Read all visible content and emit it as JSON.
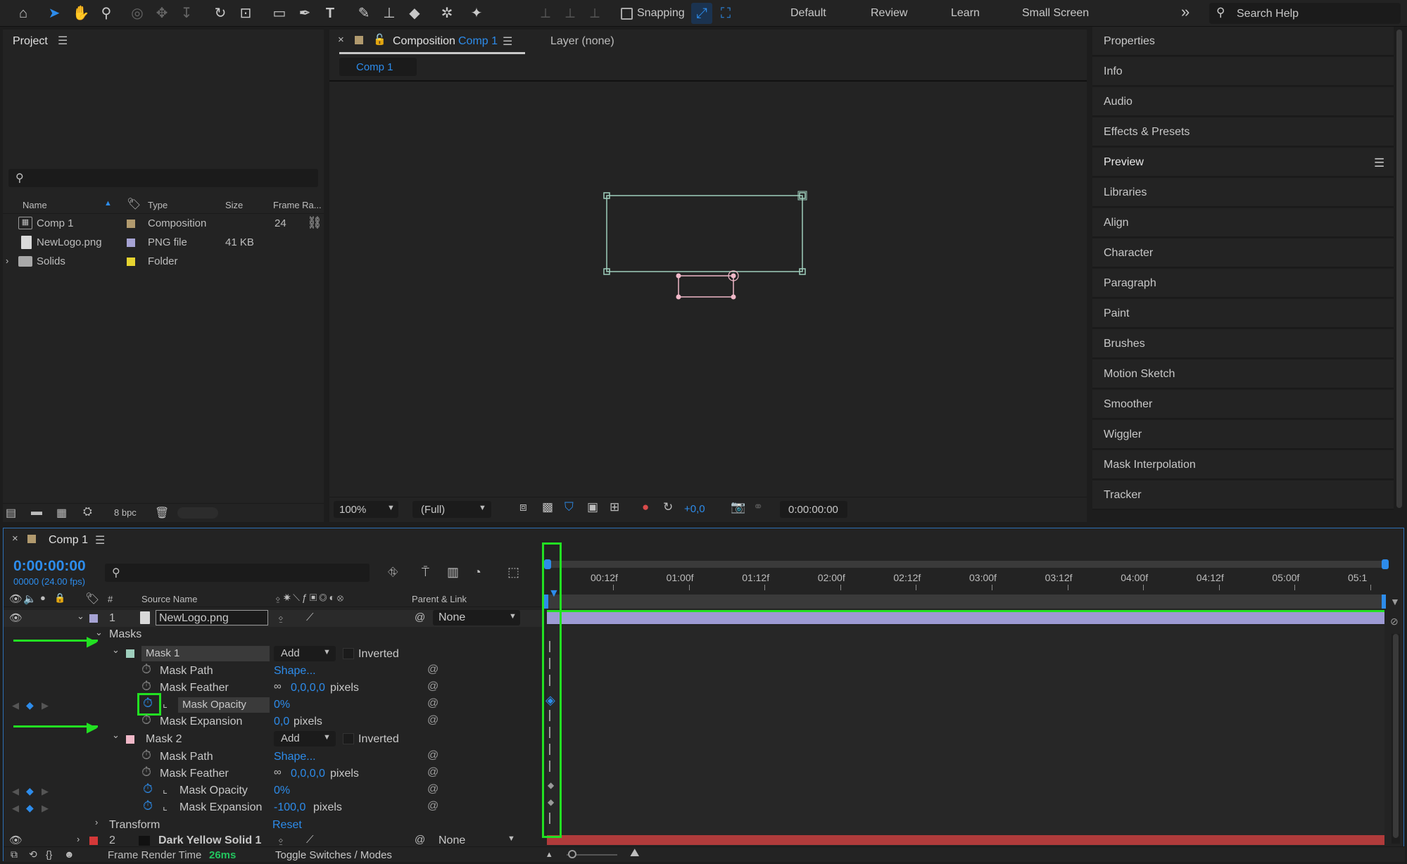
{
  "toolbar": {
    "snapping_label": "Snapping",
    "workspaces": [
      "Default",
      "Review",
      "Learn",
      "Small Screen"
    ],
    "search_placeholder": "Search Help",
    "overflow": "»"
  },
  "project": {
    "title": "Project",
    "columns": {
      "name": "Name",
      "type": "Type",
      "size": "Size",
      "frame_rate": "Frame Ra..."
    },
    "items": [
      {
        "name": "Comp 1",
        "type": "Composition",
        "size": "",
        "frame_rate": "24",
        "label_color": "#b19a6e",
        "icon": "composition-icon"
      },
      {
        "name": "NewLogo.png",
        "type": "PNG file",
        "size": "41 KB",
        "frame_rate": "",
        "label_color": "#a6a3d4",
        "icon": "file-icon"
      },
      {
        "name": "Solids",
        "type": "Folder",
        "size": "",
        "frame_rate": "",
        "label_color": "#e6d430",
        "icon": "folder-icon"
      }
    ],
    "bpc": "8 bpc"
  },
  "comp_panel": {
    "tab_prefix": "Composition",
    "tab_comp": "Comp 1",
    "layer_tab": "Layer (none)",
    "sub_tab": "Comp 1",
    "zoom": "100%",
    "resolution": "(Full)",
    "exposure": "+0,0",
    "timecode": "0:00:00:00"
  },
  "right_panels": [
    "Properties",
    "Info",
    "Audio",
    "Effects & Presets",
    "Preview",
    "Libraries",
    "Align",
    "Character",
    "Paragraph",
    "Paint",
    "Brushes",
    "Motion Sketch",
    "Smoother",
    "Wiggler",
    "Mask Interpolation",
    "Tracker"
  ],
  "timeline": {
    "tab": "Comp 1",
    "timecode": "0:00:00:00",
    "fps": "00000 (24.00 fps)",
    "col_num": "#",
    "col_source": "Source Name",
    "col_parent": "Parent & Link",
    "ruler": [
      "00:12f",
      "01:00f",
      "01:12f",
      "02:00f",
      "02:12f",
      "03:00f",
      "03:12f",
      "04:00f",
      "04:12f",
      "05:00f",
      "05:1"
    ],
    "layer1": {
      "num": "1",
      "name": "NewLogo.png",
      "parent": "None",
      "color": "#a6a3d4"
    },
    "masks_label": "Masks",
    "mask1": {
      "name": "Mask 1",
      "mode": "Add",
      "inverted": "Inverted",
      "color": "#9fcfbd",
      "path_label": "Mask Path",
      "path_value": "Shape...",
      "feather_label": "Mask Feather",
      "feather_value": "0,0,0,0",
      "feather_unit": "pixels",
      "opacity_label": "Mask Opacity",
      "opacity_value": "0%",
      "expansion_label": "Mask Expansion",
      "expansion_value": "0,0",
      "expansion_unit": "pixels"
    },
    "mask2": {
      "name": "Mask 2",
      "mode": "Add",
      "inverted": "Inverted",
      "color": "#f0b8c8",
      "path_label": "Mask Path",
      "path_value": "Shape...",
      "feather_label": "Mask Feather",
      "feather_value": "0,0,0,0",
      "feather_unit": "pixels",
      "opacity_label": "Mask Opacity",
      "opacity_value": "0%",
      "expansion_label": "Mask Expansion",
      "expansion_value": "-100,0",
      "expansion_unit": "pixels"
    },
    "transform_label": "Transform",
    "transform_value": "Reset",
    "layer2": {
      "num": "2",
      "name": "Dark Yellow Solid 1",
      "parent": "None",
      "color": "#d43838"
    },
    "render_label": "Frame Render Time",
    "render_value": "26ms",
    "toggle_label": "Toggle Switches / Modes"
  }
}
